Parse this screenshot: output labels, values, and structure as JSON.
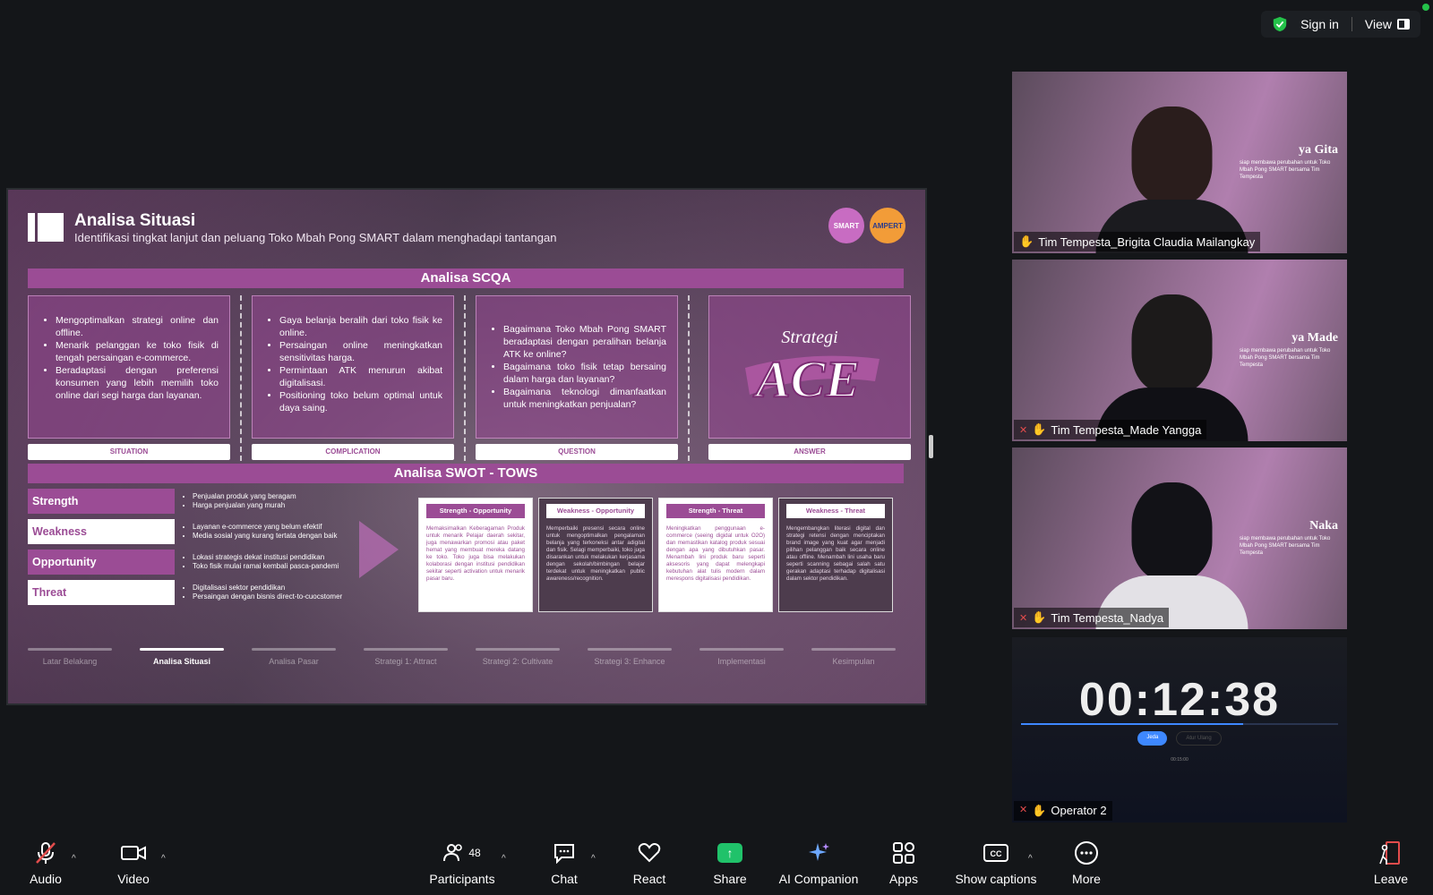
{
  "topbar": {
    "sign_in": "Sign in",
    "view": "View"
  },
  "slide": {
    "title": "Analisa Situasi",
    "subtitle": "Identifikasi tingkat lanjut dan peluang Toko Mbah Pong SMART dalam menghadapi tantangan",
    "scqa_header": "Analisa SCQA",
    "situation": {
      "label": "SITUATION",
      "items": [
        "Mengoptimalkan strategi online dan offline.",
        "Menarik pelanggan ke toko fisik di tengah persaingan e-commerce.",
        "Beradaptasi dengan preferensi konsumen yang lebih memilih toko online dari segi harga dan layanan."
      ]
    },
    "complication": {
      "label": "COMPLICATION",
      "items": [
        "Gaya belanja beralih dari toko fisik ke online.",
        "Persaingan online meningkatkan sensitivitas harga.",
        "Permintaan ATK menurun akibat digitalisasi.",
        "Positioning toko belum optimal untuk daya saing."
      ]
    },
    "question": {
      "label": "QUESTION",
      "items": [
        "Bagaimana Toko Mbah Pong SMART beradaptasi dengan peralihan belanja ATK ke online?",
        "Bagaimana toko fisik tetap bersaing dalam harga dan layanan?",
        "Bagaimana teknologi dimanfaatkan untuk meningkatkan penjualan?"
      ]
    },
    "answer": {
      "label": "ANSWER",
      "word_top": "Strategi",
      "word_main": "ACE"
    },
    "swot_header": "Analisa SWOT - TOWS",
    "swot": [
      {
        "name": "Strength",
        "items": [
          "Penjualan produk yang beragam",
          "Harga penjualan yang murah"
        ]
      },
      {
        "name": "Weakness",
        "items": [
          "Layanan e-commerce yang belum efektif",
          "Media sosial yang kurang tertata dengan baik"
        ]
      },
      {
        "name": "Opportunity",
        "items": [
          "Lokasi strategis dekat institusi pendidikan",
          "Toko fisik mulai ramai kembali pasca-pandemi"
        ]
      },
      {
        "name": "Threat",
        "items": [
          "Digitalisasi sektor pendidikan",
          "Persaingan dengan bisnis direct-to-cuocstomer"
        ]
      }
    ],
    "tows": [
      {
        "title": "Strength - Opportunity",
        "text": "Memaksimalkan Keberagaman Produk untuk menarik Pelajar daerah sekitar, juga menawarkan promosi atau paket hemat yang membuat mereka datang ke toko. Toko juga bisa melakukan kolaborasi dengan institusi pendidikan sekitar seperti activation untuk menarik pasar baru."
      },
      {
        "title": "Weakness - Opportunity",
        "text": "Memperbaiki presensi secara online untuk mengoptimalkan pengalaman belanja yang terkoneksi antar adigital dan fisik. Selagi memperbaiki, toko juga disarankan untuk melakukan kerjasama dengan sekolah/bimbingan belajar terdekat untuk meningkatkan public awareness/recognition."
      },
      {
        "title": "Strength - Threat",
        "text": "Meningkatkan penggunaan e-commerce (seeing digidal untuk O2O) dan memastikan katalog produk sesuai dengan apa yang dibutuhkan pasar. Menambah lini produk baru seperti aksesoris yang dapat melengkapi kebutuhan alat tulis modern dalam merespons digitalisasi pendidikan."
      },
      {
        "title": "Weakness - Threat",
        "text": "Mengembangkan literasi digital dan strategi retensi dengan menciptakan brand image yang kuat agar menjadi pilihan pelanggan baik secara online atau offline. Menambah lini usaha baru seperti scanning sebagai salah satu gerakan adaptasi terhadap digitalisasi dalam sektor pendidikan."
      }
    ],
    "nav": [
      "Latar Belakang",
      "Analisa Situasi",
      "Analisa Pasar",
      "Strategi 1: Attract",
      "Strategi 2: Cultivate",
      "Strategi 3: Enhance",
      "Implementasi",
      "Kesimpulan"
    ],
    "nav_active": 1,
    "badges": [
      "SMART",
      "AMPERT"
    ]
  },
  "participants": [
    {
      "name": "Tim Tempesta_Brigita Claudia Mailangkay",
      "banner": "ya Gita",
      "muted": false,
      "speaking": true
    },
    {
      "name": "Tim Tempesta_Made Yangga",
      "banner": "ya Made",
      "muted": true,
      "speaking": false
    },
    {
      "name": "Tim Tempesta_Nadya",
      "banner": "Naka",
      "muted": true,
      "speaking": false
    }
  ],
  "banner_sub": "siap membawa perubahan untuk Toko Mbah Pong SMART bersama Tim Tempesta",
  "timer": {
    "display": "00:12:38",
    "btn_primary": "Jeda",
    "btn_secondary": "Atur Ulang",
    "small": "00:15:00",
    "name": "Operator 2",
    "progress": 0.7
  },
  "toolbar": {
    "audio": "Audio",
    "video": "Video",
    "participants": "Participants",
    "participant_count": "48",
    "chat": "Chat",
    "react": "React",
    "share": "Share",
    "ai_companion": "AI Companion",
    "apps": "Apps",
    "captions": "Show captions",
    "more": "More",
    "leave": "Leave"
  }
}
